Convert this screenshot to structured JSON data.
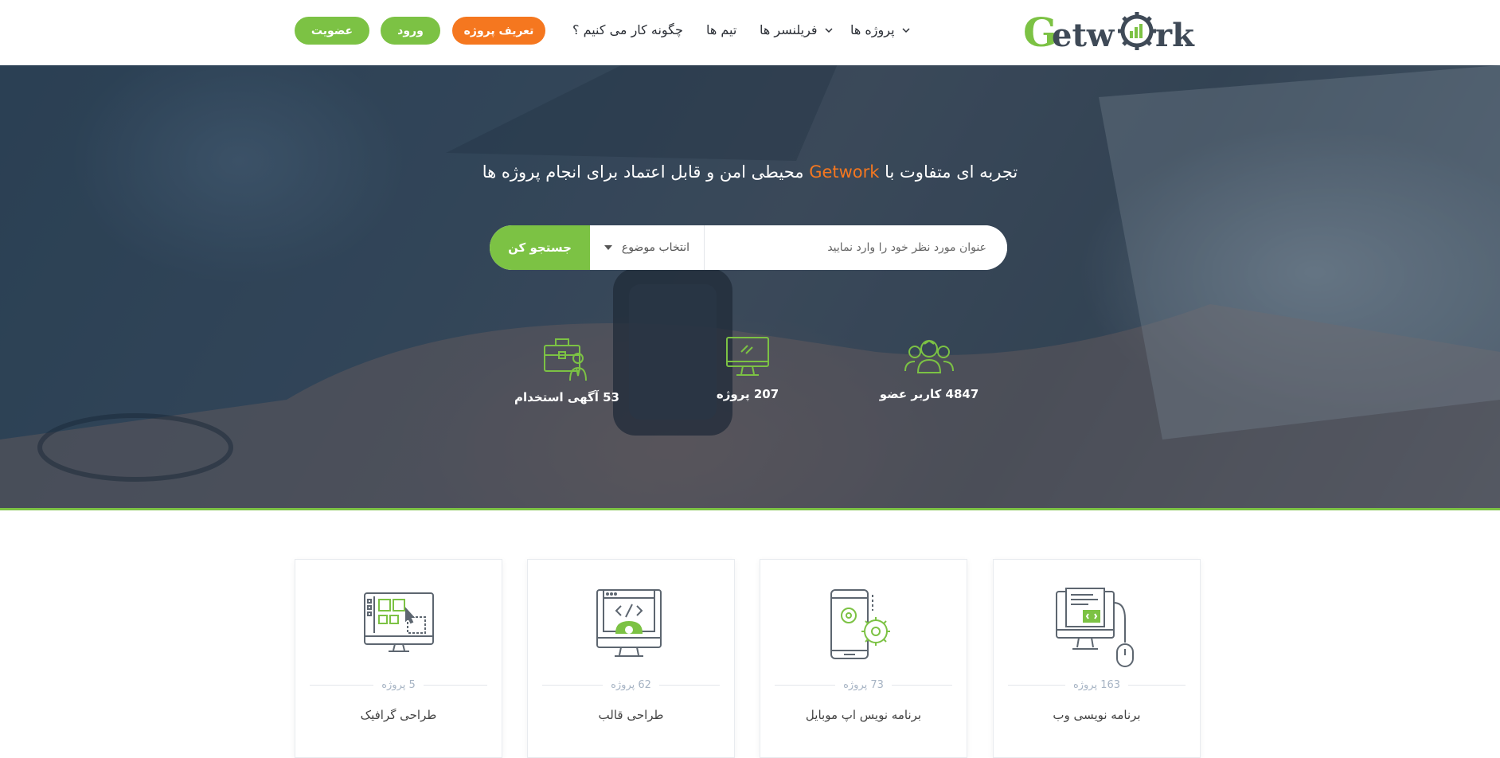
{
  "header": {
    "logo_text": "Getwork",
    "nav": {
      "projects": "پروژه ها",
      "freelancers": "فریلنسر ها",
      "teams": "تیم ها",
      "how_it_works": "چگونه کار می کنیم ؟"
    },
    "buttons": {
      "post_project": "تعریف پروژه",
      "login": "ورود",
      "signup": "عضویت"
    }
  },
  "hero": {
    "title_before": "تجربه ای متفاوت با ",
    "title_brand": "Getwork",
    "title_after": " محیطی امن و قابل اعتماد برای انجام پروژه ها",
    "search": {
      "placeholder": "عنوان مورد نظر خود را وارد نمایید",
      "select_value": "انتخاب موضوع",
      "button": "جستجو کن"
    },
    "stats": [
      {
        "label": "4847 کاربر عضو",
        "icon": "users-icon"
      },
      {
        "label": "207 پروژه",
        "icon": "monitor-icon"
      },
      {
        "label": "53 آگهی استخدام",
        "icon": "briefcase-icon"
      }
    ]
  },
  "categories": [
    {
      "title": "برنامه نویسی وب",
      "count": "163 پروژه",
      "icon": "web-code-icon"
    },
    {
      "title": "برنامه نویس اپ موبایل",
      "count": "73 پروژه",
      "icon": "mobile-gears-icon"
    },
    {
      "title": "طراحی قالب",
      "count": "62 پروژه",
      "icon": "template-code-icon"
    },
    {
      "title": "طراحی گرافیک",
      "count": "5 پروژه",
      "icon": "graphic-design-icon"
    }
  ],
  "colors": {
    "accent_green": "#7cc244",
    "accent_orange": "#f5771f",
    "icon_gray": "#5d6670"
  }
}
